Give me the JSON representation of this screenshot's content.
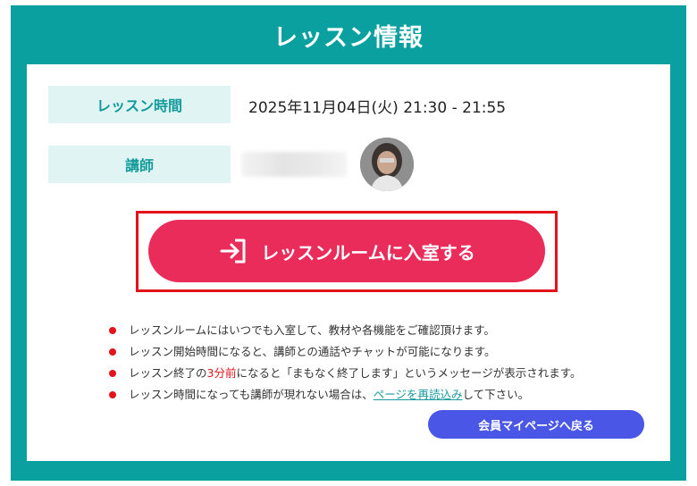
{
  "page": {
    "title": "レッスン情報"
  },
  "lesson": {
    "time_label": "レッスン時間",
    "time_value": "2025年11月04日(火) 21:30 - 21:55",
    "teacher_label": "講師"
  },
  "actions": {
    "enter_room_label": "レッスンルームに入室する",
    "enter_icon": "sign-in-icon",
    "back_label": "会員マイページへ戻る"
  },
  "notes": {
    "n1": "レッスンルームにはいつでも入室して、教材や各機能をご確認頂けます。",
    "n2": "レッスン開始時間になると、講師との通話やチャットが可能になります。",
    "n3_pre": "レッスン終了の",
    "n3_highlight": "3分前",
    "n3_post": "になると「まもなく終了します」というメッセージが表示されます。",
    "n4_pre": "レッスン時間になっても講師が現れない場合は、",
    "n4_link": "ページを再読込み",
    "n4_post": "して下さい。"
  },
  "colors": {
    "frame": "#0aa0a0",
    "label_bg": "#e0f4f4",
    "label_text": "#139a9a",
    "enter_button": "#ea2c5a",
    "highlight_outline": "#e3131b",
    "back_button": "#4a56e6"
  }
}
